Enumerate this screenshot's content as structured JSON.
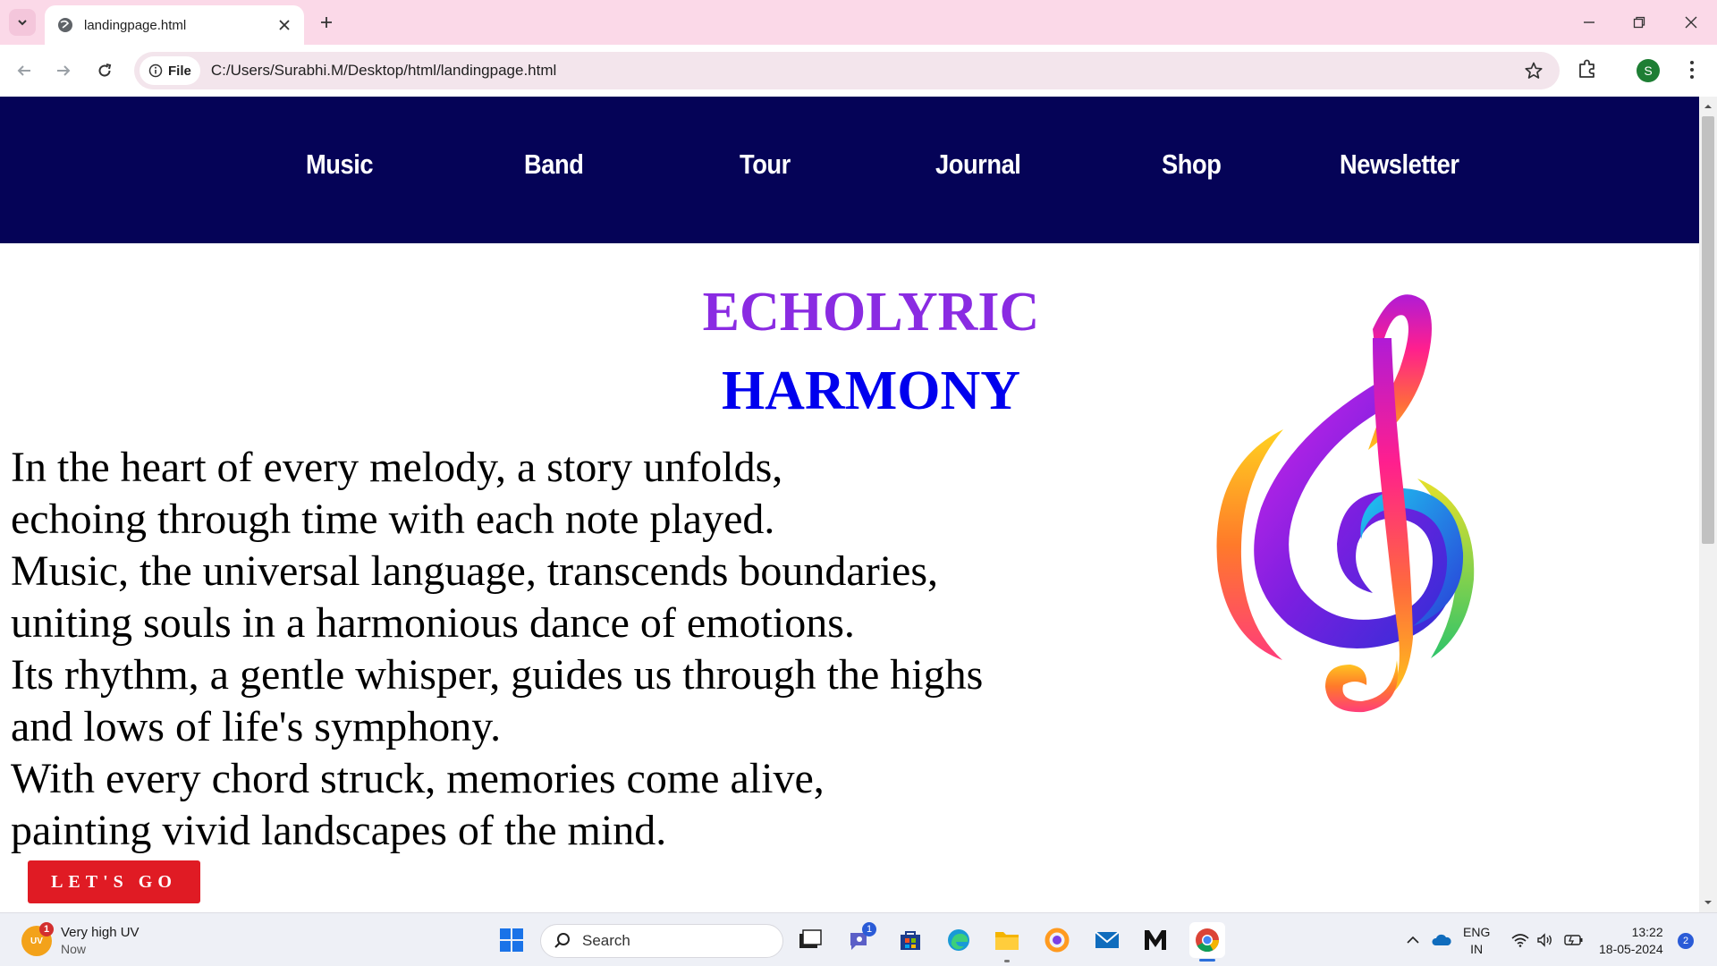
{
  "browser": {
    "tab_title": "landingpage.html",
    "chip_label": "File",
    "url": "C:/Users/Surabhi.M/Desktop/html/landingpage.html",
    "profile_initial": "S"
  },
  "site": {
    "nav": [
      "Music",
      "Band",
      "Tour",
      "Journal",
      "Shop",
      "Newsletter"
    ],
    "heading_1": "ECHOLYRIC",
    "heading_2": "HARMONY",
    "poem": [
      "In the heart of every melody, a story unfolds,",
      "echoing through time with each note played.",
      "Music, the universal language, transcends boundaries,",
      "uniting souls in a harmonious dance of emotions.",
      "Its rhythm, a gentle whisper, guides us through the highs",
      "and lows of life's symphony.",
      "With every chord struck, memories come alive,",
      "painting vivid landscapes of the mind."
    ],
    "cta_label": "LET'S GO",
    "colors": {
      "nav_bg": "#050357",
      "heading_1": "#8a2be2",
      "heading_2": "#0000ee",
      "cta_bg": "#e01b24"
    },
    "image_icon": "treble-clef-icon"
  },
  "taskbar": {
    "weather_title": "Very high UV",
    "weather_sub": "Now",
    "weather_badge": "1",
    "weather_icon_text": "UV",
    "search_placeholder": "Search",
    "teams_badge": "1",
    "lang_line1": "ENG",
    "lang_line2": "IN",
    "time": "13:22",
    "date": "18-05-2024",
    "notification_count": "2"
  }
}
